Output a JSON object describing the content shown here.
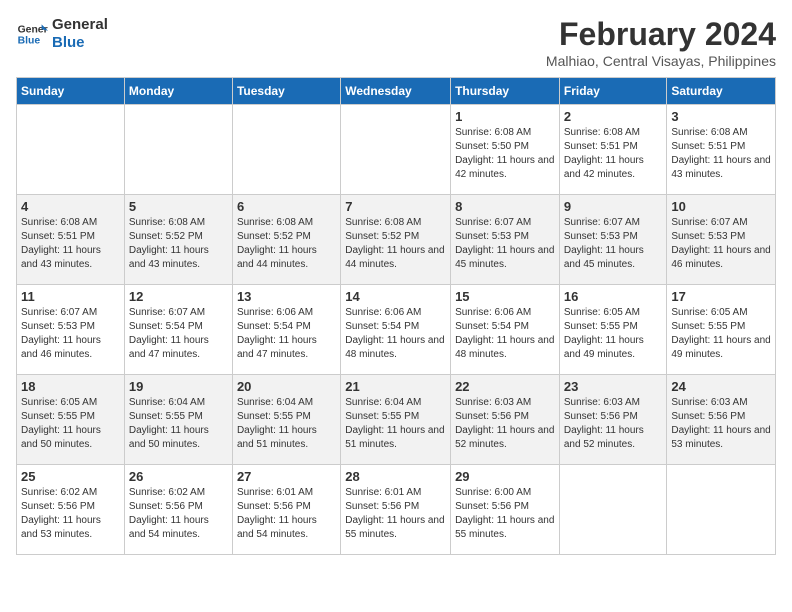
{
  "logo": {
    "text_general": "General",
    "text_blue": "Blue"
  },
  "title": {
    "month_year": "February 2024",
    "location": "Malhiao, Central Visayas, Philippines"
  },
  "headers": [
    "Sunday",
    "Monday",
    "Tuesday",
    "Wednesday",
    "Thursday",
    "Friday",
    "Saturday"
  ],
  "weeks": [
    [
      {
        "day": "",
        "sunrise": "",
        "sunset": "",
        "daylight": ""
      },
      {
        "day": "",
        "sunrise": "",
        "sunset": "",
        "daylight": ""
      },
      {
        "day": "",
        "sunrise": "",
        "sunset": "",
        "daylight": ""
      },
      {
        "day": "",
        "sunrise": "",
        "sunset": "",
        "daylight": ""
      },
      {
        "day": "1",
        "sunrise": "Sunrise: 6:08 AM",
        "sunset": "Sunset: 5:50 PM",
        "daylight": "Daylight: 11 hours and 42 minutes."
      },
      {
        "day": "2",
        "sunrise": "Sunrise: 6:08 AM",
        "sunset": "Sunset: 5:51 PM",
        "daylight": "Daylight: 11 hours and 42 minutes."
      },
      {
        "day": "3",
        "sunrise": "Sunrise: 6:08 AM",
        "sunset": "Sunset: 5:51 PM",
        "daylight": "Daylight: 11 hours and 43 minutes."
      }
    ],
    [
      {
        "day": "4",
        "sunrise": "Sunrise: 6:08 AM",
        "sunset": "Sunset: 5:51 PM",
        "daylight": "Daylight: 11 hours and 43 minutes."
      },
      {
        "day": "5",
        "sunrise": "Sunrise: 6:08 AM",
        "sunset": "Sunset: 5:52 PM",
        "daylight": "Daylight: 11 hours and 43 minutes."
      },
      {
        "day": "6",
        "sunrise": "Sunrise: 6:08 AM",
        "sunset": "Sunset: 5:52 PM",
        "daylight": "Daylight: 11 hours and 44 minutes."
      },
      {
        "day": "7",
        "sunrise": "Sunrise: 6:08 AM",
        "sunset": "Sunset: 5:52 PM",
        "daylight": "Daylight: 11 hours and 44 minutes."
      },
      {
        "day": "8",
        "sunrise": "Sunrise: 6:07 AM",
        "sunset": "Sunset: 5:53 PM",
        "daylight": "Daylight: 11 hours and 45 minutes."
      },
      {
        "day": "9",
        "sunrise": "Sunrise: 6:07 AM",
        "sunset": "Sunset: 5:53 PM",
        "daylight": "Daylight: 11 hours and 45 minutes."
      },
      {
        "day": "10",
        "sunrise": "Sunrise: 6:07 AM",
        "sunset": "Sunset: 5:53 PM",
        "daylight": "Daylight: 11 hours and 46 minutes."
      }
    ],
    [
      {
        "day": "11",
        "sunrise": "Sunrise: 6:07 AM",
        "sunset": "Sunset: 5:53 PM",
        "daylight": "Daylight: 11 hours and 46 minutes."
      },
      {
        "day": "12",
        "sunrise": "Sunrise: 6:07 AM",
        "sunset": "Sunset: 5:54 PM",
        "daylight": "Daylight: 11 hours and 47 minutes."
      },
      {
        "day": "13",
        "sunrise": "Sunrise: 6:06 AM",
        "sunset": "Sunset: 5:54 PM",
        "daylight": "Daylight: 11 hours and 47 minutes."
      },
      {
        "day": "14",
        "sunrise": "Sunrise: 6:06 AM",
        "sunset": "Sunset: 5:54 PM",
        "daylight": "Daylight: 11 hours and 48 minutes."
      },
      {
        "day": "15",
        "sunrise": "Sunrise: 6:06 AM",
        "sunset": "Sunset: 5:54 PM",
        "daylight": "Daylight: 11 hours and 48 minutes."
      },
      {
        "day": "16",
        "sunrise": "Sunrise: 6:05 AM",
        "sunset": "Sunset: 5:55 PM",
        "daylight": "Daylight: 11 hours and 49 minutes."
      },
      {
        "day": "17",
        "sunrise": "Sunrise: 6:05 AM",
        "sunset": "Sunset: 5:55 PM",
        "daylight": "Daylight: 11 hours and 49 minutes."
      }
    ],
    [
      {
        "day": "18",
        "sunrise": "Sunrise: 6:05 AM",
        "sunset": "Sunset: 5:55 PM",
        "daylight": "Daylight: 11 hours and 50 minutes."
      },
      {
        "day": "19",
        "sunrise": "Sunrise: 6:04 AM",
        "sunset": "Sunset: 5:55 PM",
        "daylight": "Daylight: 11 hours and 50 minutes."
      },
      {
        "day": "20",
        "sunrise": "Sunrise: 6:04 AM",
        "sunset": "Sunset: 5:55 PM",
        "daylight": "Daylight: 11 hours and 51 minutes."
      },
      {
        "day": "21",
        "sunrise": "Sunrise: 6:04 AM",
        "sunset": "Sunset: 5:55 PM",
        "daylight": "Daylight: 11 hours and 51 minutes."
      },
      {
        "day": "22",
        "sunrise": "Sunrise: 6:03 AM",
        "sunset": "Sunset: 5:56 PM",
        "daylight": "Daylight: 11 hours and 52 minutes."
      },
      {
        "day": "23",
        "sunrise": "Sunrise: 6:03 AM",
        "sunset": "Sunset: 5:56 PM",
        "daylight": "Daylight: 11 hours and 52 minutes."
      },
      {
        "day": "24",
        "sunrise": "Sunrise: 6:03 AM",
        "sunset": "Sunset: 5:56 PM",
        "daylight": "Daylight: 11 hours and 53 minutes."
      }
    ],
    [
      {
        "day": "25",
        "sunrise": "Sunrise: 6:02 AM",
        "sunset": "Sunset: 5:56 PM",
        "daylight": "Daylight: 11 hours and 53 minutes."
      },
      {
        "day": "26",
        "sunrise": "Sunrise: 6:02 AM",
        "sunset": "Sunset: 5:56 PM",
        "daylight": "Daylight: 11 hours and 54 minutes."
      },
      {
        "day": "27",
        "sunrise": "Sunrise: 6:01 AM",
        "sunset": "Sunset: 5:56 PM",
        "daylight": "Daylight: 11 hours and 54 minutes."
      },
      {
        "day": "28",
        "sunrise": "Sunrise: 6:01 AM",
        "sunset": "Sunset: 5:56 PM",
        "daylight": "Daylight: 11 hours and 55 minutes."
      },
      {
        "day": "29",
        "sunrise": "Sunrise: 6:00 AM",
        "sunset": "Sunset: 5:56 PM",
        "daylight": "Daylight: 11 hours and 55 minutes."
      },
      {
        "day": "",
        "sunrise": "",
        "sunset": "",
        "daylight": ""
      },
      {
        "day": "",
        "sunrise": "",
        "sunset": "",
        "daylight": ""
      }
    ]
  ]
}
